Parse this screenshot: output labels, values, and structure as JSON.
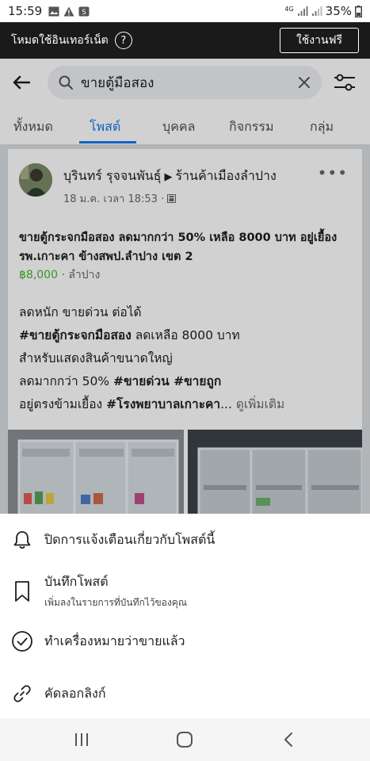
{
  "status_bar": {
    "time": "15:59",
    "network": "4G",
    "battery": "35%",
    "icons": [
      "image-icon",
      "warning-icon",
      "app-icon"
    ]
  },
  "free_mode": {
    "label": "โหมดใช้อินเทอร์เน็ต",
    "help": "?",
    "button": "ใช้งานฟรี"
  },
  "search": {
    "query": "ขายตู้มือสอง"
  },
  "tabs": [
    {
      "label": "ทั้งหมด",
      "active": false
    },
    {
      "label": "โพสต์",
      "active": true
    },
    {
      "label": "บุคคล",
      "active": false
    },
    {
      "label": "กิจกรรม",
      "active": false
    },
    {
      "label": "กลุ่ม",
      "active": false
    }
  ],
  "post": {
    "author": "บุรินทร์ รุจจนพันธุ์",
    "group": "ร้านค้าเมืองลำปาง",
    "time": "18 ม.ค. เวลา 18:53 ·",
    "title": "ขายตู้กระจกมือสอง ลดมากกว่า 50% เหลือ 8000 บาท อยู่เยื้อง รพ.เกาะคา ข้างสพป.ลำปาง เขต 2",
    "price": "฿8,000",
    "location": " · ลำปาง",
    "body": {
      "line1": "ลดหนัก ขายด่วน ต่อได้",
      "line2_tag": "#ขายตู้กระจกมือสอง",
      "line2_rest": " ลดเหลือ 8000 บาท",
      "line3": "สำหรับแสดงสินค้าขนาดใหญ่",
      "line4_pre": "ลดมากกว่า 50% ",
      "line4_tag1": "#ขายด่วน",
      "line4_tag2": " #ขายถูก",
      "line5_pre": "อยู่ตรงข้ามเยื้อง ",
      "line5_tag": "#โรงพยาบาลเกาะคา",
      "line5_ell": "...",
      "see_more": " ดูเพิ่มเติม"
    }
  },
  "sheet": {
    "items": [
      {
        "label": "ปิดการแจ้งเตือนเกี่ยวกับโพสต์นี้",
        "sub": "",
        "icon": "bell-icon"
      },
      {
        "label": "บันทึกโพสต์",
        "sub": "เพิ่มลงในรายการที่บันทึกไว้ของคุณ",
        "icon": "bookmark-icon"
      },
      {
        "label": "ทำเครื่องหมายว่าขายแล้ว",
        "sub": "",
        "icon": "check-circle-icon"
      },
      {
        "label": "คัดลอกลิงก์",
        "sub": "",
        "icon": "link-icon"
      }
    ]
  },
  "colors": {
    "accent": "#1877f2",
    "price": "#42b72a",
    "freebar": "#1a1a1a"
  }
}
